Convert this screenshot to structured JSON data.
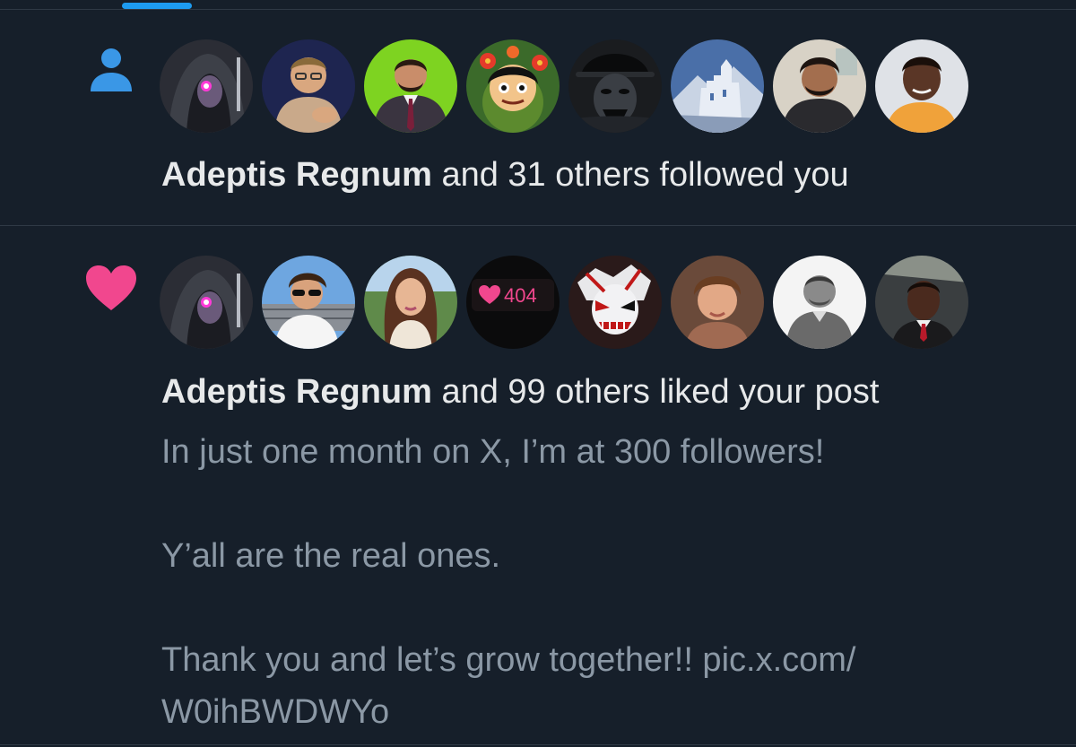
{
  "notifications": [
    {
      "kind_icon": "person-icon",
      "actor": "Adeptis Regnum",
      "rest": " and 31 others followed you",
      "avatars": [
        {
          "name": "avatar-hooded-figure"
        },
        {
          "name": "avatar-man-glasses"
        },
        {
          "name": "avatar-man-suit-green"
        },
        {
          "name": "avatar-cartoon-flowers"
        },
        {
          "name": "avatar-dark-masked"
        },
        {
          "name": "avatar-castle-mountain"
        },
        {
          "name": "avatar-man-beard"
        },
        {
          "name": "avatar-smiling-person"
        }
      ]
    },
    {
      "kind_icon": "heart-icon",
      "actor": "Adeptis Regnum",
      "rest": " and 99 others liked your post",
      "avatar_badge_text": "404",
      "avatars": [
        {
          "name": "avatar-hooded-figure"
        },
        {
          "name": "avatar-man-sunglasses"
        },
        {
          "name": "avatar-woman-long-hair"
        },
        {
          "name": "avatar-heart-404"
        },
        {
          "name": "avatar-anime-mask"
        },
        {
          "name": "avatar-young-man"
        },
        {
          "name": "avatar-man-bw"
        },
        {
          "name": "avatar-man-car"
        }
      ],
      "post": {
        "line1": "In just one month on X, I’m at 300 followers!",
        "line2": "Y’all are the real ones.",
        "line3": "Thank you and let’s grow together!! pic.x.com/",
        "line4": "W0ihBWDWYo"
      }
    }
  ],
  "colors": {
    "background": "#161f2a",
    "accent_blue": "#1d9bf0",
    "heart_pink": "#f91880",
    "primary_text": "#e7e9ea",
    "secondary_text": "#8b98a5"
  }
}
